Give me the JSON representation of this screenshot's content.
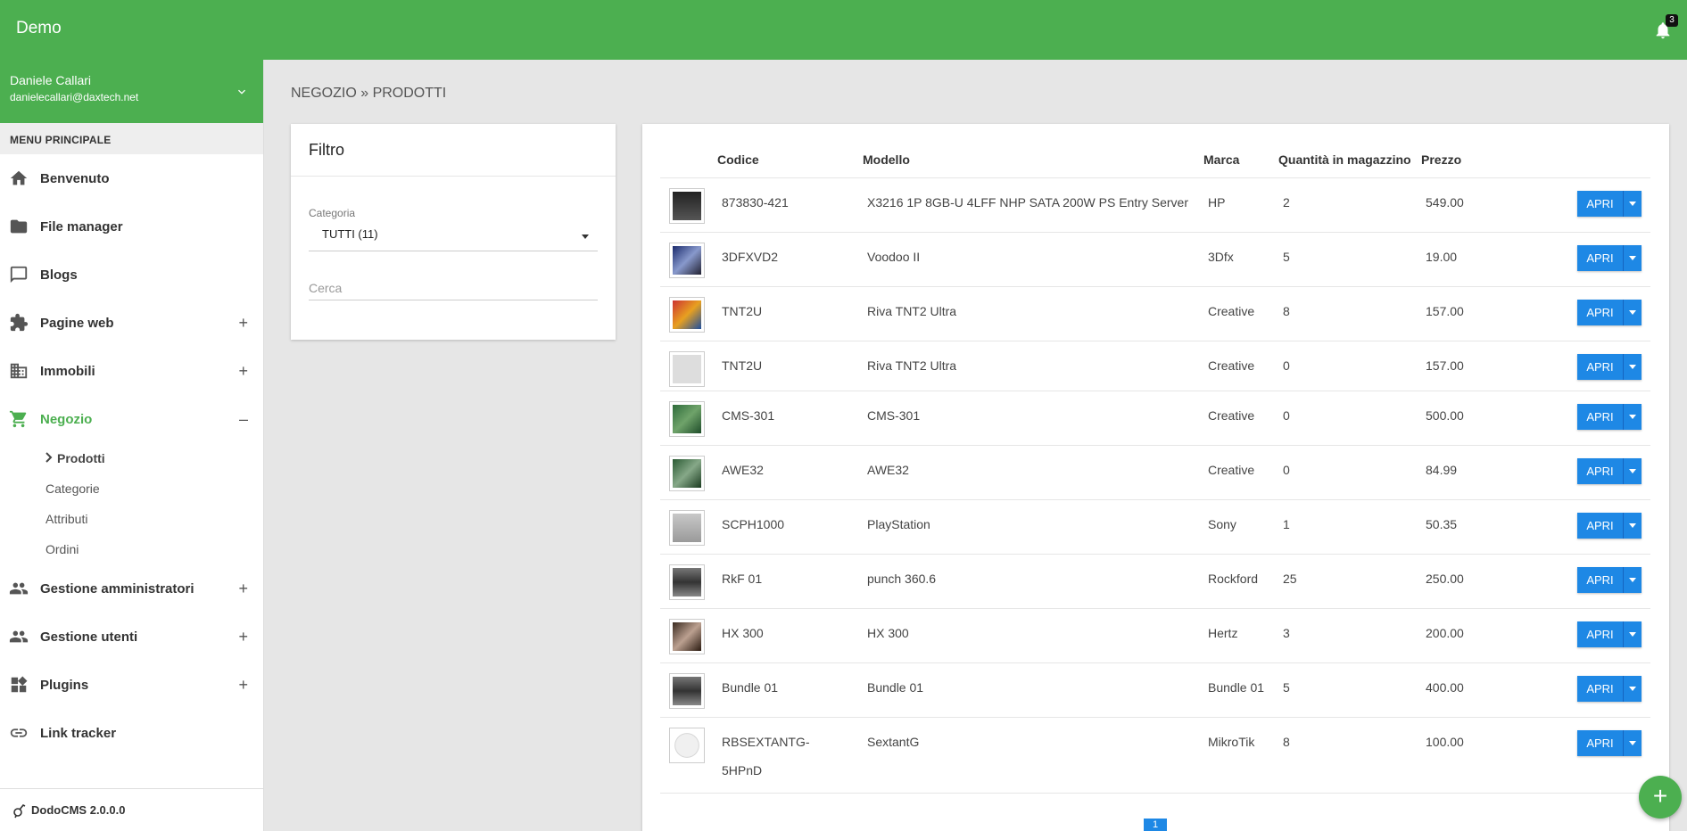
{
  "app": {
    "title": "Demo",
    "notifications_count": "3"
  },
  "user": {
    "name": "Daniele Callari",
    "email": "danielecallari@daxtech.net"
  },
  "menu": {
    "header": "MENU PRINCIPALE",
    "items": [
      {
        "label": "Benvenuto",
        "icon": "home-icon"
      },
      {
        "label": "File manager",
        "icon": "folder-icon"
      },
      {
        "label": "Blogs",
        "icon": "comment-icon"
      },
      {
        "label": "Pagine web",
        "icon": "puzzle-icon",
        "expand": "+"
      },
      {
        "label": "Immobili",
        "icon": "building-icon",
        "expand": "+"
      },
      {
        "label": "Negozio",
        "icon": "cart-icon",
        "expand": "–",
        "active": true
      },
      {
        "label": "Gestione amministratori",
        "icon": "people-icon",
        "expand": "+"
      },
      {
        "label": "Gestione utenti",
        "icon": "people-icon",
        "expand": "+"
      },
      {
        "label": "Plugins",
        "icon": "widgets-icon",
        "expand": "+"
      },
      {
        "label": "Link tracker",
        "icon": "link-icon"
      }
    ],
    "shop_subitems": {
      "active": "Prodotti",
      "others": [
        "Categorie",
        "Attributi",
        "Ordini"
      ]
    }
  },
  "footer": {
    "label": "DodoCMS 2.0.0.0"
  },
  "breadcrumb": {
    "text": "NEGOZIO » PRODOTTI"
  },
  "filter": {
    "title": "Filtro",
    "category_label": "Categoria",
    "category_value": "TUTTI (11)",
    "search_placeholder": "Cerca"
  },
  "table": {
    "headers": {
      "code": "Codice",
      "model": "Modello",
      "brand": "Marca",
      "qty": "Quantità in magazzino",
      "price": "Prezzo"
    },
    "open_label": "APRI",
    "rows": [
      {
        "code": "873830-421",
        "model": "X3216 1P 8GB-U 4LFF NHP SATA 200W PS Entry Server",
        "brand": "HP",
        "qty": "2",
        "price": "549.00"
      },
      {
        "code": "3DFXVD2",
        "model": "Voodoo II",
        "brand": "3Dfx",
        "qty": "5",
        "price": "19.00"
      },
      {
        "code": "TNT2U",
        "model": "Riva TNT2 Ultra",
        "brand": "Creative",
        "qty": "8",
        "price": "157.00"
      },
      {
        "code": "TNT2U",
        "model": "Riva TNT2 Ultra",
        "brand": "Creative",
        "qty": "0",
        "price": "157.00"
      },
      {
        "code": "CMS-301",
        "model": "CMS-301",
        "brand": "Creative",
        "qty": "0",
        "price": "500.00"
      },
      {
        "code": "AWE32",
        "model": "AWE32",
        "brand": "Creative",
        "qty": "0",
        "price": "84.99"
      },
      {
        "code": "SCPH1000",
        "model": "PlayStation",
        "brand": "Sony",
        "qty": "1",
        "price": "50.35"
      },
      {
        "code": "RkF 01",
        "model": "punch 360.6",
        "brand": "Rockford",
        "qty": "25",
        "price": "250.00"
      },
      {
        "code": "HX 300",
        "model": "HX 300",
        "brand": "Hertz",
        "qty": "3",
        "price": "200.00"
      },
      {
        "code": "Bundle 01",
        "model": "Bundle 01",
        "brand": "Bundle 01",
        "qty": "5",
        "price": "400.00"
      },
      {
        "code": "RBSEXTANTG-5HPnD",
        "model": "SextantG",
        "brand": "MikroTik",
        "qty": "8",
        "price": "100.00"
      }
    ]
  },
  "pagination": {
    "current": "1"
  },
  "fab": {
    "label": "+"
  }
}
